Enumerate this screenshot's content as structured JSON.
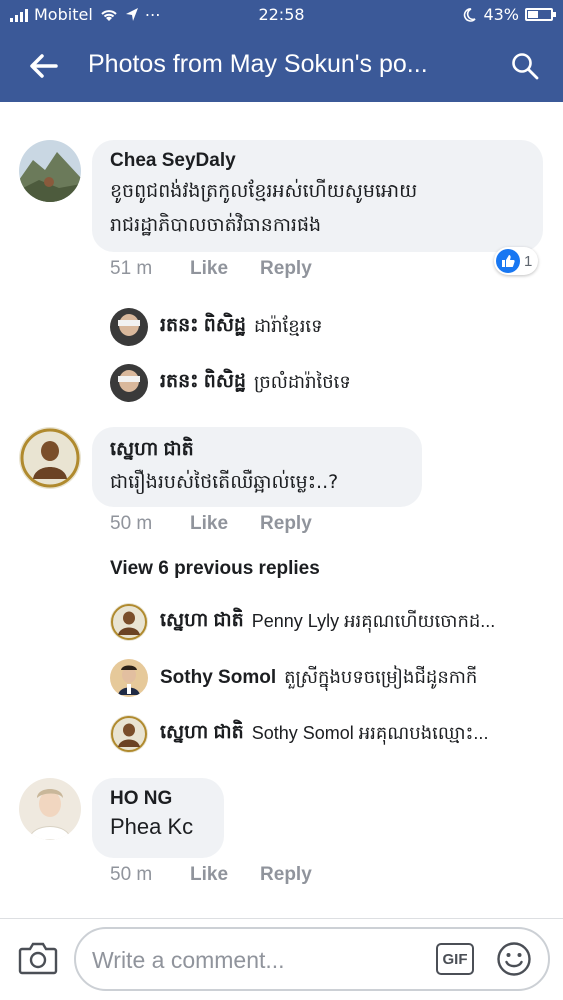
{
  "status_bar": {
    "carrier": "Mobitel",
    "time": "22:58",
    "battery": "43%"
  },
  "header": {
    "title": "Photos from May Sokun's po..."
  },
  "comments": [
    {
      "author": "Chea SeyDaly",
      "text_line1": "ខូចពូជពង់វងត្រកូលខ្មែរអស់ហើយសូមអោយ",
      "text_line2": "រាជរដ្ឋាភិបាលចាត់វិធានការផង",
      "time": "51 m",
      "like_label": "Like",
      "reply_label": "Reply",
      "like_count": "1",
      "replies": [
        {
          "author": "រតនះ ពិសិដ្ឋ",
          "text": "ដារ៉ាខ្មែរទេ"
        },
        {
          "author": "រតនះ ពិសិដ្ឋ",
          "text": "ច្រលំដារ៉ាថៃទេ"
        }
      ]
    },
    {
      "author": "ស្នេហា ជាតិ",
      "text_line1": "ជារឿងរបស់ថៃតើឈឺឆ្អាល់ម្លេះ..?",
      "time": "50 m",
      "like_label": "Like",
      "reply_label": "Reply",
      "view_previous": "View 6 previous replies",
      "replies": [
        {
          "author": "ស្នេហា ជាតិ",
          "text": "Penny Lyly អរគុណហើយចោកដ..."
        },
        {
          "author": "Sothy Somol",
          "text": "តួស្រីក្នុងបទចម្រៀងជីដូនកាកី"
        },
        {
          "author": "ស្នេហា ជាតិ",
          "text": "Sothy Somol អរគុណបងឈ្មោះ..."
        }
      ]
    },
    {
      "author": "HO NG",
      "text_line1": "Phea Kc",
      "time": "50 m",
      "like_label": "Like",
      "reply_label": "Reply"
    }
  ],
  "composer": {
    "placeholder": "Write a comment...",
    "gif_label": "GIF"
  },
  "colors": {
    "brand": "#3b5998",
    "bubble": "#f0f2f5",
    "muted": "#90949c",
    "like_blue": "#1877f2"
  }
}
